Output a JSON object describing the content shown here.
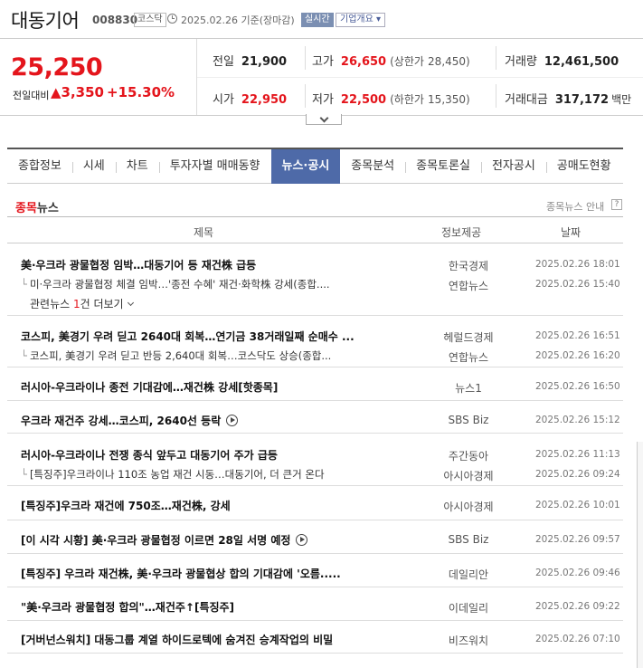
{
  "stock": {
    "name": "대동기어",
    "code": "008830",
    "market": "코스닥",
    "date_info": "2025.02.26  기준(장마감)",
    "realtime_label": "실시간",
    "company_info_label": "기업개요",
    "price": "25,250",
    "change_label": "전일대비",
    "change_amount": "▲3,350",
    "change_pct": "+15.30%"
  },
  "stats": {
    "prev_close": {
      "label": "전일",
      "value": "21,900"
    },
    "high": {
      "label": "고가",
      "value": "26,650",
      "sub_label": "(상한가",
      "sub_value": "28,450)"
    },
    "volume": {
      "label": "거래량",
      "value": "12,461,500"
    },
    "open": {
      "label": "시가",
      "value": "22,950"
    },
    "low": {
      "label": "저가",
      "value": "22,500",
      "sub_label": "(하한가",
      "sub_value": "15,350)"
    },
    "amount": {
      "label": "거래대금",
      "value": "317,172",
      "unit": "백만"
    }
  },
  "tabs": [
    "종합정보",
    "시세",
    "차트",
    "투자자별 매매동향",
    "뉴스·공시",
    "종목분석",
    "종목토론실",
    "전자공시",
    "공매도현황"
  ],
  "news": {
    "section_title_highlight": "종목",
    "section_title_rest": "뉴스",
    "guide_label": "종목뉴스 안내",
    "help_label": "?",
    "columns": {
      "title": "제목",
      "source": "정보제공",
      "date": "날짜"
    },
    "sub_prefix": "└",
    "related": {
      "prefix": "관련뉴스 ",
      "count": "1",
      "suffix": "건 더보기"
    },
    "items": [
      {
        "title": "美·우크라 광물협정 임박…대동기어 등 재건株 급등",
        "source": "한국경제",
        "date": "2025.02.26 18:01",
        "sub": {
          "title": "미·우크라 광물협정 체결 임박…'종전 수혜' 재건·화학株 강세(종합....",
          "source": "연합뉴스",
          "date": "2025.02.26 15:40"
        }
      },
      {
        "title": "코스피, 美경기 우려 딛고 2640대 회복…연기금 38거래일째 순매수 ...",
        "source": "헤럴드경제",
        "date": "2025.02.26 16:51",
        "sub": {
          "title": "코스피, 美경기 우려 딛고 반등 2,640대 회복…코스닥도 상승(종합...",
          "source": "연합뉴스",
          "date": "2025.02.26 16:20"
        }
      },
      {
        "title": "러시아-우크라이나 종전 기대감에…재건株 강세[핫종목]",
        "source": "뉴스1",
        "date": "2025.02.26 16:50"
      },
      {
        "title": "우크라 재건주 강세…코스피, 2640선 등락",
        "source": "SBS Biz",
        "date": "2025.02.26 15:12",
        "video": true
      },
      {
        "title": "러시아-우크라이나 전쟁 종식 앞두고 대동기어 주가 급등",
        "source": "주간동아",
        "date": "2025.02.26 11:13",
        "sub": {
          "title": "[특징주]우크라이나 110조 농업 재건 시동…대동기어, 더 큰거 온다",
          "source": "아시아경제",
          "date": "2025.02.26 09:24"
        }
      },
      {
        "title": "[특징주]우크라 재건에 750조…재건株, 강세",
        "source": "아시아경제",
        "date": "2025.02.26 10:01"
      },
      {
        "title": "[이 시각 시황] 美·우크라 광물협정 이르면 28일 서명 예정",
        "source": "SBS Biz",
        "date": "2025.02.26 09:57",
        "video": true
      },
      {
        "title": "[특징주] 우크라 재건株, 美·우크라 광물협상 합의 기대감에 '오름.....",
        "source": "데일리안",
        "date": "2025.02.26 09:46"
      },
      {
        "title": "\"美·우크라 광물협정 합의\"…재건주↑[특징주]",
        "source": "이데일리",
        "date": "2025.02.26 09:22"
      },
      {
        "title": "[거버넌스워치] 대동그룹 계열 하이드로텍에 숨겨진 승계작업의 비밀",
        "source": "비즈워치",
        "date": "2025.02.26 07:10"
      }
    ]
  }
}
